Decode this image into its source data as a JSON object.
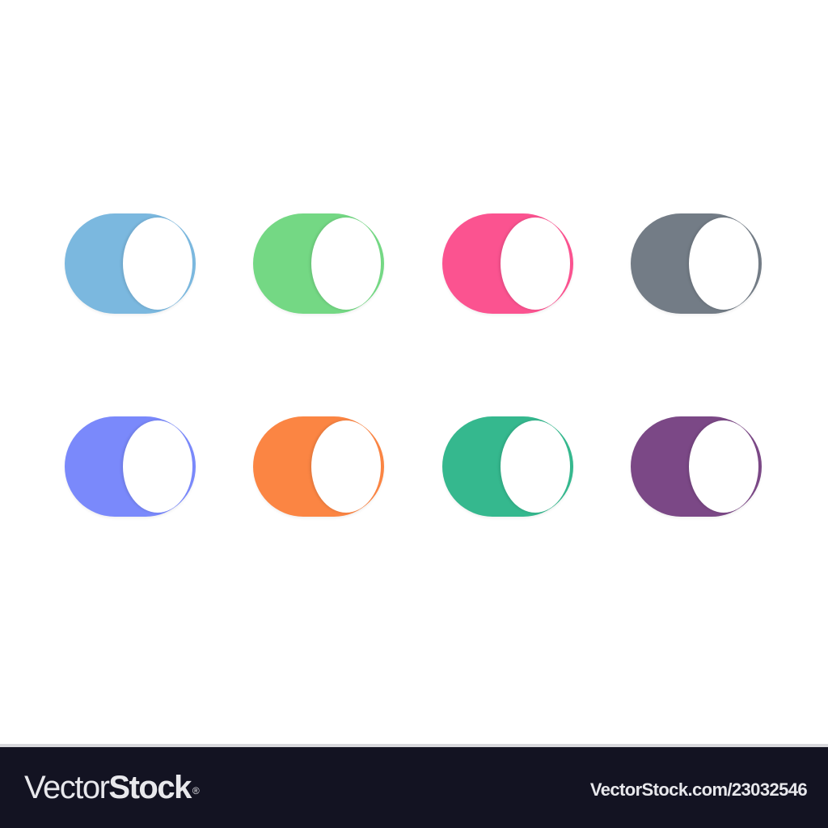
{
  "toggles": [
    {
      "name": "toggle-blue",
      "color": "#7bb8df",
      "state": "on"
    },
    {
      "name": "toggle-green",
      "color": "#74d884",
      "state": "on"
    },
    {
      "name": "toggle-pink",
      "color": "#fb5390",
      "state": "on"
    },
    {
      "name": "toggle-gray",
      "color": "#737c86",
      "state": "on"
    },
    {
      "name": "toggle-indigo",
      "color": "#7a89fb",
      "state": "on"
    },
    {
      "name": "toggle-orange",
      "color": "#fb8543",
      "state": "on"
    },
    {
      "name": "toggle-teal",
      "color": "#35b88e",
      "state": "on"
    },
    {
      "name": "toggle-purple",
      "color": "#7b4886",
      "state": "on"
    }
  ],
  "footer": {
    "brand_light": "Vector",
    "brand_bold": "Stock",
    "brand_mark": "®",
    "stock_url": "VectorStock.com/23032546"
  },
  "colors": {
    "footer_background": "#131322",
    "footer_text": "#e8e8ec",
    "knob": "#ffffff"
  }
}
